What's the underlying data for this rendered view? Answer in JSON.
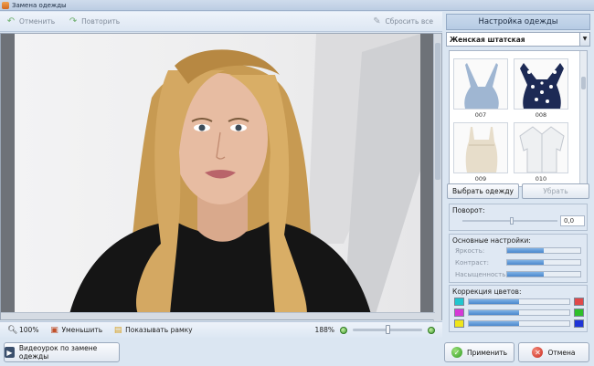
{
  "window": {
    "title": "Замена одежды"
  },
  "toolbar": {
    "undo_label": "Отменить",
    "redo_label": "Повторить",
    "reset_label": "Сбросить все"
  },
  "status": {
    "zoom_fit": "100%",
    "shrink_label": "Уменьшить",
    "show_frame_label": "Показывать рамку",
    "zoom_level": "188%",
    "zoom_slider_fraction": 0.5
  },
  "panel": {
    "title": "Настройка одежды",
    "category_selected": "Женская штатская",
    "items": [
      {
        "code": "007",
        "color": "#9fb6d2"
      },
      {
        "code": "008",
        "color": "#1d2a55"
      },
      {
        "code": "009",
        "color": "#e7ddca"
      },
      {
        "code": "010",
        "color": "#eef0f2"
      }
    ],
    "choose_button": "Выбрать одежду",
    "remove_button": "Убрать",
    "rotation": {
      "title": "Поворот:",
      "value": "0,0"
    },
    "basic": {
      "title": "Основные настройки:",
      "brightness_label": "Яркость:",
      "contrast_label": "Контраст:",
      "saturation_label": "Насыщенность:",
      "brightness": 0.5,
      "contrast": 0.5,
      "saturation": 0.5
    },
    "color_correction": {
      "title": "Коррекция цветов:",
      "rows": [
        {
          "left": "#21c6cf",
          "right": "#e0494a",
          "level": 0.5
        },
        {
          "left": "#d638d6",
          "right": "#2ebf2a",
          "level": 0.5
        },
        {
          "left": "#f0e51a",
          "right": "#1e34d8",
          "level": 0.5
        }
      ]
    }
  },
  "bottom": {
    "video_button": "Видеоурок по замене одежды",
    "apply_button": "Применить",
    "cancel_button": "Отмена"
  }
}
